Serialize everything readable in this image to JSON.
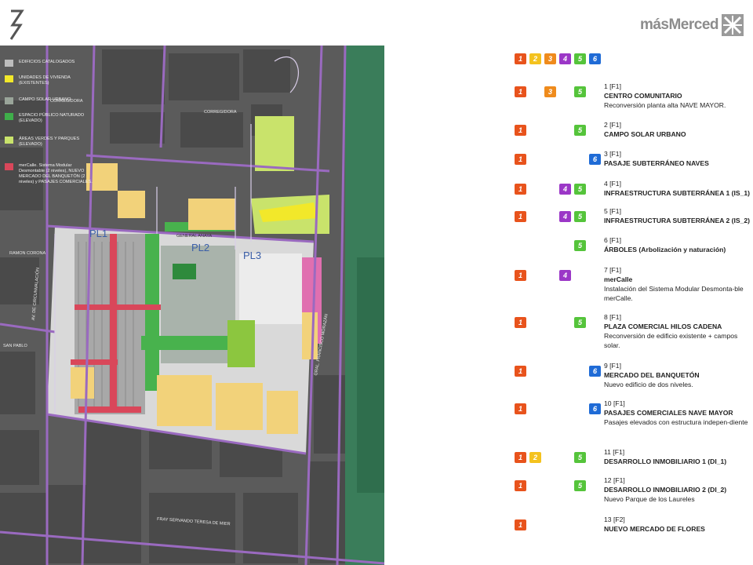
{
  "brand": {
    "name": "másMerced"
  },
  "map_legend": [
    {
      "label": "EDIFICIOS CATALOGADOS",
      "color": "#bdbdbd"
    },
    {
      "label": "UNIDADES DE VIVIENDA (EXISTENTES)",
      "color": "#f2e82a"
    },
    {
      "label": "CAMPO SOLAR URBANO",
      "color": "#9aa59a"
    },
    {
      "label": "ESPACIO PÚBLICO NATURADO (ELEVADO)",
      "color": "#3fae4a"
    },
    {
      "label": "ÁREAS VERDES Y PARQUES (ELEVADO)",
      "color": "#c9e36b"
    },
    {
      "label": "merCalle. Sistema Modular Desmontable (2 niveles), NUEVO MERCADO DEL BANQUETÓN (2 niveles) y PASAJES COMERCIALES.",
      "color": "#d9475a"
    }
  ],
  "map_labels": {
    "street_corregidora_1": "CORREGIDORA",
    "street_corregidora_2": "CORREGIDORA",
    "street_general_anaya": "GENERAL ANAYA",
    "street_ramon_corona": "RAMON CORONA",
    "street_san_pablo": "SAN PABLO",
    "street_fray_servando": "FRAY SERVANDO TERESA DE MIER",
    "street_circunvalacion": "AV. DE CIRCUNVALACIÓN",
    "street_morazan": "GRAL. FRANCISCO MORAZÁN",
    "pl1": "PL1",
    "pl2": "PL2",
    "pl3": "PL3"
  },
  "header_badges": [
    {
      "text": "1",
      "cls": "b1"
    },
    {
      "text": "2",
      "cls": "b2"
    },
    {
      "text": "3",
      "cls": "b3"
    },
    {
      "text": "4",
      "cls": "b4"
    },
    {
      "text": "5",
      "cls": "b5"
    },
    {
      "text": "6",
      "cls": "b6"
    }
  ],
  "entries": [
    {
      "id": "1 [F1]",
      "title": "CENTRO COMUNITARIO",
      "desc": "Reconversión planta alta NAVE MAYOR.",
      "badges": [
        "1",
        "3",
        "5"
      ]
    },
    {
      "id": "2  [F1]",
      "title": "CAMPO SOLAR URBANO",
      "desc": "",
      "badges": [
        "1",
        "5"
      ]
    },
    {
      "id": "3 [F1]",
      "title": "PASAJE SUBTERRÁNEO NAVES",
      "desc": "",
      "badges": [
        "1",
        "6"
      ]
    },
    {
      "id": "4 [F1]",
      "title": "INFRAESTRUCTURA SUBTERRÁNEA 1 (IS_1)",
      "desc": "",
      "badges": [
        "1",
        "4",
        "5"
      ]
    },
    {
      "id": "5 [F1]",
      "title": "INFRAESTRUCTURA SUBTERRÁNEA 2 (IS_2)",
      "desc": "",
      "badges": [
        "1",
        "4",
        "5"
      ]
    },
    {
      "id": "6 [F1]",
      "title": "ÁRBOLES (Arbolización y naturación)",
      "desc": "",
      "badges": [
        "5"
      ]
    },
    {
      "id": "7 [F1]",
      "title": "merCalle",
      "desc": "Instalación del Sistema Modular Desmonta-ble merCalle.",
      "badges": [
        "1",
        "4"
      ]
    },
    {
      "id": "8 [F1]",
      "title": "PLAZA COMERCIAL HILOS CADENA",
      "desc": "Reconversión de edificio existente + campos solar.",
      "badges": [
        "1",
        "5"
      ]
    },
    {
      "id": "9 [F1]",
      "title": "MERCADO DEL BANQUETÓN",
      "desc": "Nuevo edificio de dos niveles.",
      "badges": [
        "1",
        "6"
      ]
    },
    {
      "id": "10  [F1]",
      "title": "PASAJES COMERCIALES NAVE MAYOR",
      "desc": "Pasajes elevados con estructura indepen-diente",
      "badges": [
        "1",
        "6"
      ]
    },
    {
      "id": "11  [F1]",
      "title": "DESARROLLO INMOBILIARIO 1 (DI_1)",
      "desc": "",
      "badges": [
        "1",
        "2",
        "5"
      ]
    },
    {
      "id": "12 [F1]",
      "title": "DESARROLLO INMOBILIARIO 2 (DI_2)",
      "desc": "Nuevo Parque de los Laureles",
      "badges": [
        "1",
        "5"
      ]
    },
    {
      "id": "13 [F2]",
      "title": "NUEVO MERCADO DE FLORES",
      "desc": "",
      "badges": [
        "1"
      ]
    }
  ]
}
